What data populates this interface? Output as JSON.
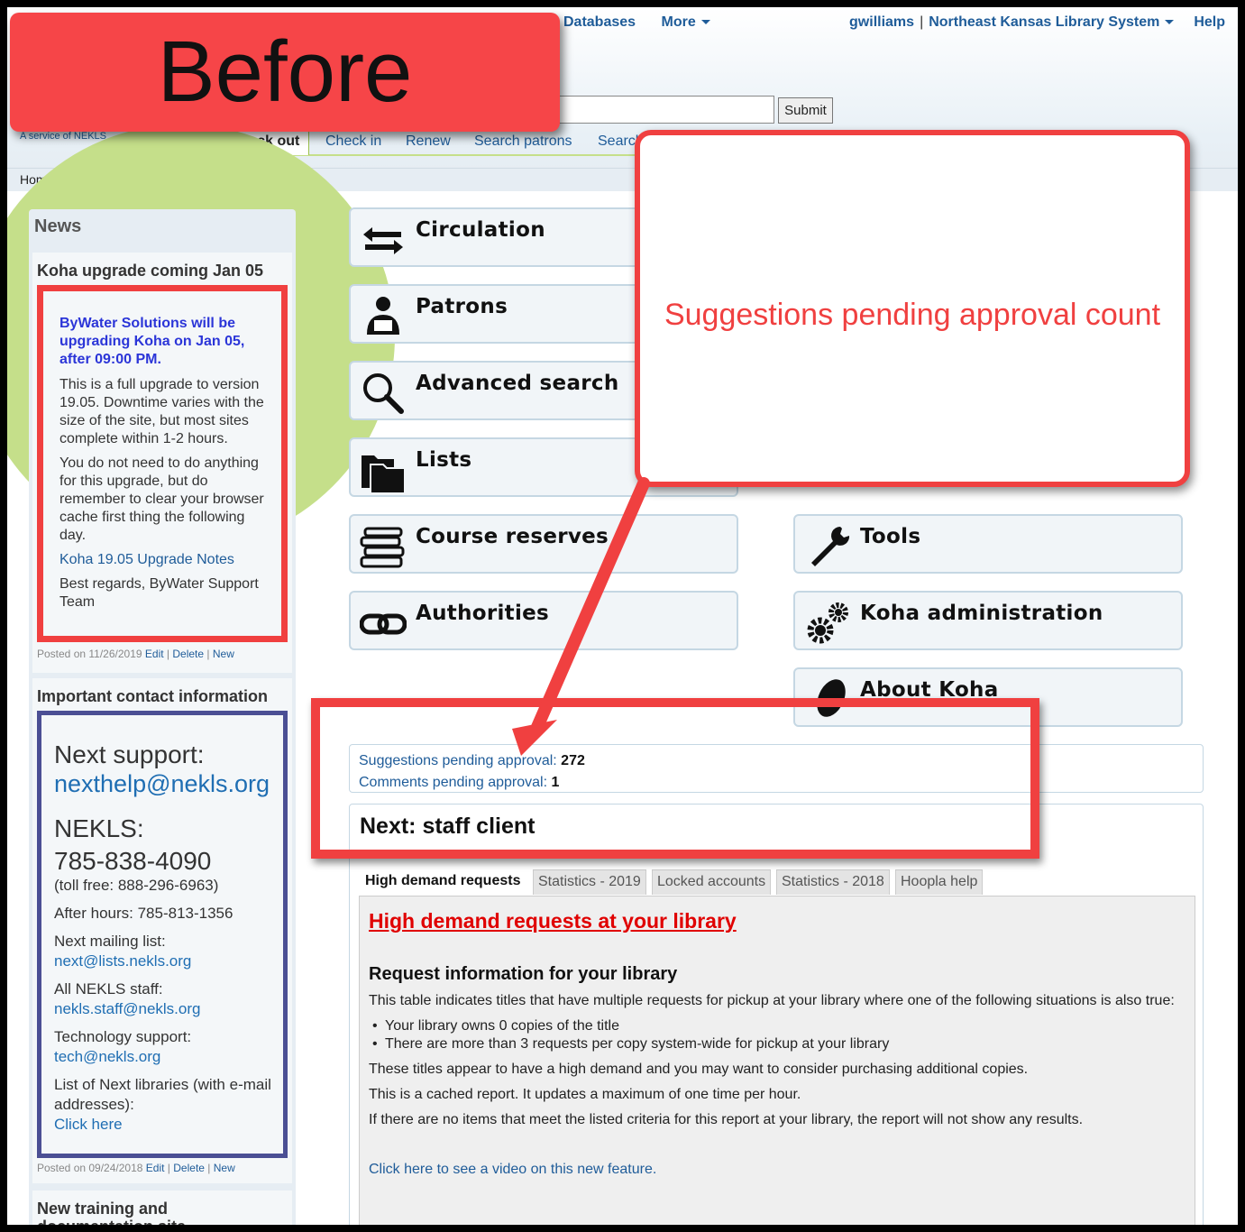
{
  "annotation": {
    "before_label": "Before",
    "callout_text": "Suggestions pending approval count"
  },
  "header": {
    "nav_left": [
      "Databases",
      "More"
    ],
    "user": "gwilliams",
    "library": "Northeast Kansas Library System",
    "help": "Help",
    "submit_label": "Submit",
    "service_text": "A service of NEKLS",
    "quick_links": [
      "Check out",
      "Check in",
      "Renew",
      "Search patrons",
      "Search"
    ]
  },
  "breadcrumb": "Home",
  "news": {
    "title": "News",
    "item1": {
      "heading": "Koha upgrade coming Jan 05",
      "headline": "ByWater Solutions will be upgrading Koha on Jan 05, after 09:00 PM.",
      "p1": "This is a full upgrade to version 19.05. Downtime varies with the size of the site, but most sites complete within 1-2 hours.",
      "p2": "You do not need to do anything for this upgrade, but do remember to clear your browser cache first thing the following day.",
      "link": "Koha 19.05 Upgrade Notes",
      "p3": "Best regards, ByWater Support Team",
      "posted": "Posted on 11/26/2019",
      "edit": "Edit",
      "delete": "Delete",
      "new": "New"
    },
    "item2": {
      "heading": "Important contact information",
      "next_support": "Next support:",
      "next_support_email": "nexthelp@nekls.org",
      "nekls": "NEKLS:",
      "nekls_phone": "785-838-4090",
      "toll_free": "(toll free: 888-296-6963)",
      "after_hours": "After hours: 785-813-1356",
      "mailing_list": "Next mailing list:",
      "mailing_list_email": "next@lists.nekls.org",
      "all_staff": "All NEKLS staff:",
      "all_staff_email": "nekls.staff@nekls.org",
      "tech_support": "Technology support:",
      "tech_support_email": "tech@nekls.org",
      "list_libraries": "List of Next libraries (with e-mail addresses):",
      "click_here": "Click here",
      "posted": "Posted on 09/24/2018",
      "edit": "Edit",
      "delete": "Delete",
      "new": "New"
    },
    "item3": {
      "heading": "New training and documentation site"
    }
  },
  "modules": {
    "circulation": "Circulation",
    "patrons": "Patrons",
    "advanced_search": "Advanced search",
    "lists": "Lists",
    "course_reserves": "Course reserves",
    "authorities": "Authorities",
    "tools": "Tools",
    "koha_admin": "Koha administration",
    "about": "About Koha"
  },
  "pending": {
    "suggestions_label": "Suggestions pending approval:",
    "suggestions_count": "272",
    "comments_label": "Comments pending approval:",
    "comments_count": "1"
  },
  "main": {
    "title": "Next: staff client",
    "tabs": [
      "High demand requests",
      "Statistics - 2019",
      "Locked accounts",
      "Statistics - 2018",
      "Hoopla help"
    ],
    "hd_link": "High demand requests at your library",
    "req_title": "Request information for your library",
    "intro": "This table indicates titles that have multiple requests for pickup at your library where one of the following situations is also true:",
    "bullets": [
      "Your library owns 0 copies of the title",
      "There are more than 3 requests per copy system-wide for pickup at your library"
    ],
    "p_demand": "These titles appear to have a high demand and you may want to consider purchasing additional copies.",
    "p_cached": "This is a cached report. It updates a maximum of one time per hour.",
    "p_none": "If there are no items that meet the listed criteria for this report at your library, the report will not show any results.",
    "video_link": "Click here to see a video on this new feature."
  }
}
